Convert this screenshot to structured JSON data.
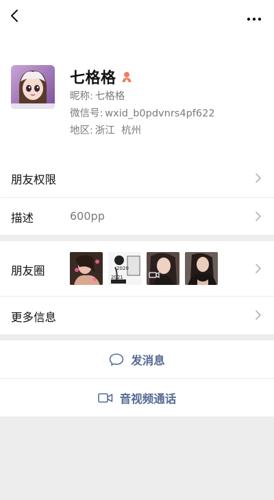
{
  "profile": {
    "name": "七格格",
    "nickname_label": "昵称:",
    "nickname": "七格格",
    "wechat_label": "微信号:",
    "wechat_id": "wxid_b0pdvnrs4pf622",
    "region_label": "地区:",
    "region": "浙江  杭州"
  },
  "cells": {
    "permissions": "朋友权限",
    "description_label": "描述",
    "description_value": "600pp",
    "moments": "朋友圈",
    "more_info": "更多信息"
  },
  "moments_thumbs": [
    {
      "text": ""
    },
    {
      "text_top": "2020",
      "text_mid": "2021"
    },
    {
      "text": ""
    },
    {
      "text": ""
    }
  ],
  "actions": {
    "message": "发消息",
    "call": "音视频通话"
  },
  "colors": {
    "accent": "#576b95",
    "gender": "#f37e5f",
    "background": "#ededed"
  },
  "icons": {
    "back": "chevron-left-icon",
    "more": "ellipsis-icon",
    "gender": "female-icon",
    "chevron": "chevron-right-icon",
    "message": "chat-bubble-icon",
    "call": "video-camera-icon"
  }
}
